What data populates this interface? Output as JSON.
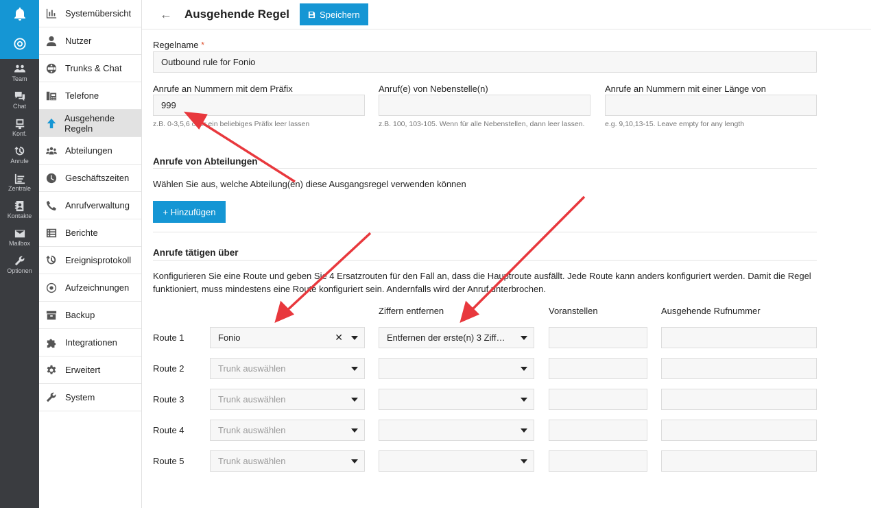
{
  "rail": {
    "items": [
      {
        "label": "Team",
        "icon": "team-icon"
      },
      {
        "label": "Chat",
        "icon": "chat-icon"
      },
      {
        "label": "Konf.",
        "icon": "conference-icon"
      },
      {
        "label": "Anrufe",
        "icon": "history-icon"
      },
      {
        "label": "Zentrale",
        "icon": "switchboard-icon"
      },
      {
        "label": "Kontakte",
        "icon": "contacts-icon"
      },
      {
        "label": "Mailbox",
        "icon": "mailbox-icon"
      },
      {
        "label": "Optionen",
        "icon": "wrench-icon"
      }
    ]
  },
  "sidebar": {
    "items": [
      {
        "label": "Systemübersicht",
        "icon": "dashboard-icon"
      },
      {
        "label": "Nutzer",
        "icon": "user-icon"
      },
      {
        "label": "Trunks & Chat",
        "icon": "globe-icon"
      },
      {
        "label": "Telefone",
        "icon": "phone-device-icon"
      },
      {
        "label": "Ausgehende Regeln",
        "icon": "arrow-up-icon",
        "active": true
      },
      {
        "label": "Abteilungen",
        "icon": "group-icon"
      },
      {
        "label": "Geschäftszeiten",
        "icon": "clock-icon"
      },
      {
        "label": "Anrufverwaltung",
        "icon": "phone-icon"
      },
      {
        "label": "Berichte",
        "icon": "list-icon"
      },
      {
        "label": "Ereignisprotokoll",
        "icon": "history-icon"
      },
      {
        "label": "Aufzeichnungen",
        "icon": "record-icon"
      },
      {
        "label": "Backup",
        "icon": "archive-icon"
      },
      {
        "label": "Integrationen",
        "icon": "puzzle-icon"
      },
      {
        "label": "Erweitert",
        "icon": "gear-icon"
      },
      {
        "label": "System",
        "icon": "wrench-icon"
      }
    ]
  },
  "header": {
    "back": "←",
    "title": "Ausgehende Regel",
    "save_label": "Speichern"
  },
  "form": {
    "rule_name_label": "Regelname",
    "required_mark": "*",
    "rule_name_value": "Outbound rule for Fonio",
    "prefix_label": "Anrufe an Nummern mit dem Präfix",
    "prefix_value": "999",
    "prefix_hint": "z.B. 0-3,5,6 oder ein beliebiges Präfix leer lassen",
    "extensions_label": "Anruf(e) von Nebenstelle(n)",
    "extensions_value": "",
    "extensions_hint": "z.B. 100, 103-105. Wenn für alle Nebenstellen, dann leer lassen.",
    "length_label": "Anrufe an Nummern mit einer Länge von",
    "length_value": "",
    "length_hint": "e.g. 9,10,13-15. Leave empty for any length"
  },
  "departments": {
    "title": "Anrufe von Abteilungen",
    "desc": "Wählen Sie aus, welche Abteilung(en) diese Ausgangsregel verwenden können",
    "add_label": "+ Hinzufügen"
  },
  "routes": {
    "title": "Anrufe tätigen über",
    "desc": "Konfigurieren Sie eine Route und geben Sie 4 Ersatzrouten für den Fall an, dass die Hauptroute ausfällt. Jede Route kann anders konfiguriert werden. Damit die Regel funktioniert, muss mindestens eine Route konfiguriert sein. Andernfalls wird der Anruf unterbrochen.",
    "columns": {
      "strip": "Ziffern entfernen",
      "prepend": "Voranstellen",
      "outbound": "Ausgehende Rufnummer"
    },
    "placeholder": "Trunk auswählen",
    "clear_symbol": "✕",
    "rows": [
      {
        "label": "Route 1",
        "trunk": "Fonio",
        "strip": "Entfernen der erste(n) 3 Ziff…"
      },
      {
        "label": "Route 2",
        "trunk": "",
        "strip": ""
      },
      {
        "label": "Route 3",
        "trunk": "",
        "strip": ""
      },
      {
        "label": "Route 4",
        "trunk": "",
        "strip": ""
      },
      {
        "label": "Route 5",
        "trunk": "",
        "strip": ""
      }
    ]
  },
  "colors": {
    "accent": "#1596d4",
    "rail": "#3a3c40",
    "arrow": "#e8383d"
  }
}
